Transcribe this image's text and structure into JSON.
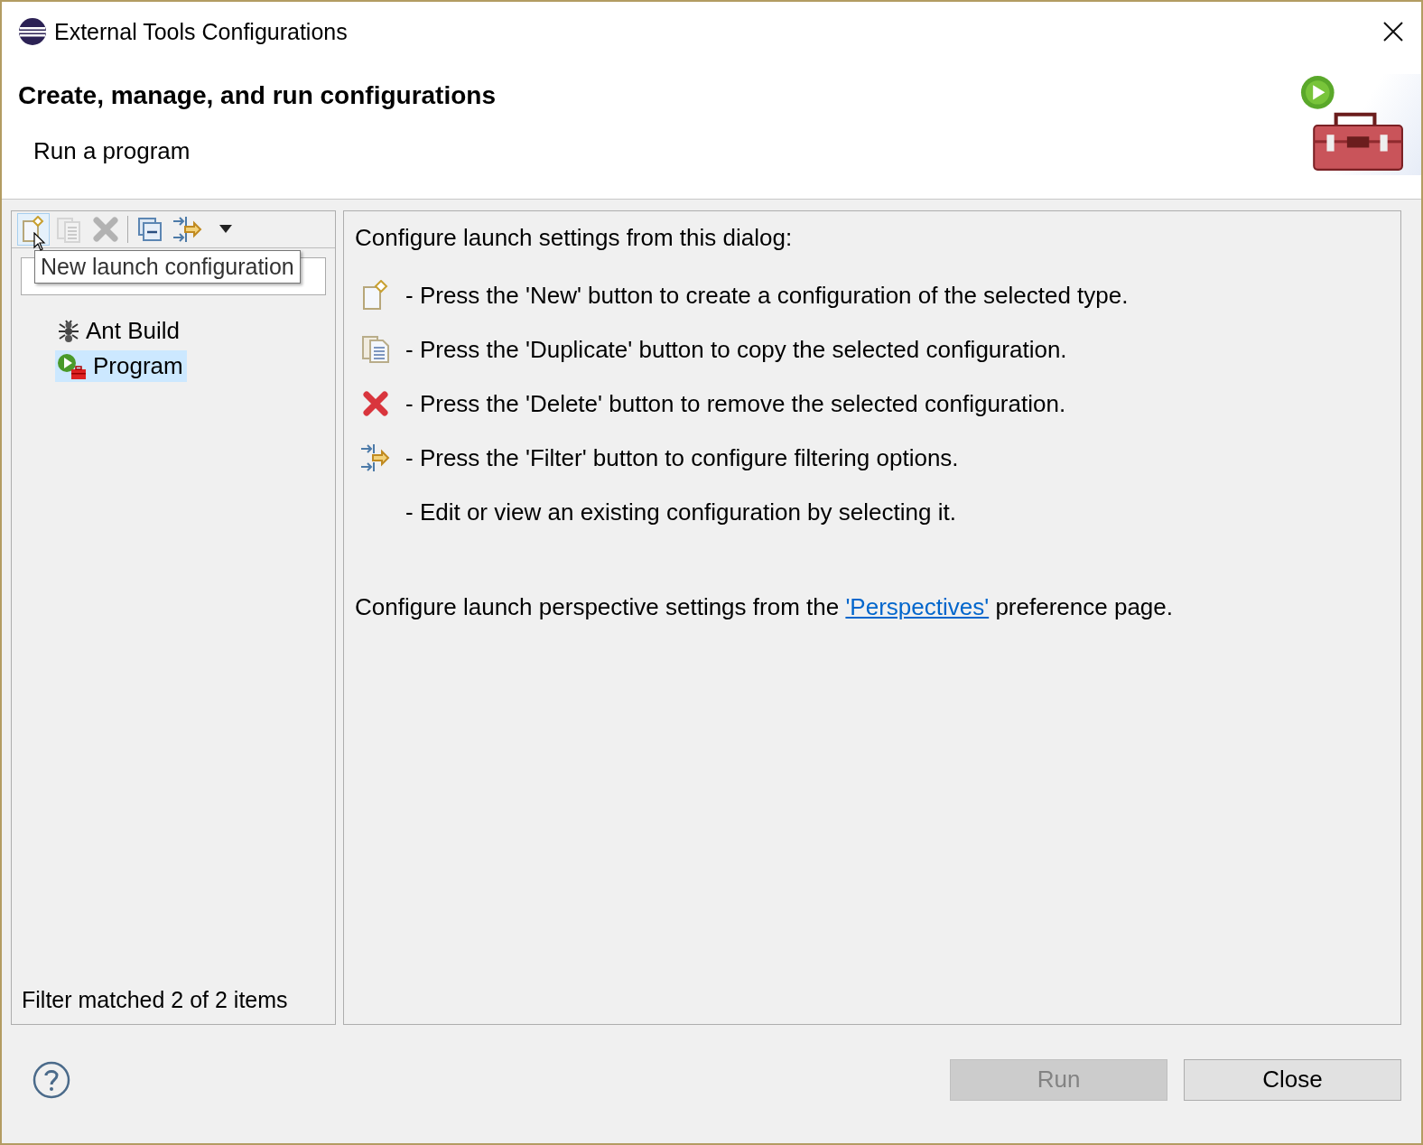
{
  "window": {
    "title": "External Tools Configurations"
  },
  "header": {
    "title": "Create, manage, and run configurations",
    "subtitle": "Run a program"
  },
  "toolbar": {
    "buttons": [
      {
        "kind": "new",
        "disabled": false,
        "hovered": true
      },
      {
        "kind": "duplicate",
        "disabled": true,
        "hovered": false
      },
      {
        "kind": "delete",
        "disabled": true,
        "hovered": false
      },
      {
        "kind": "collapse",
        "disabled": false,
        "hovered": false
      },
      {
        "kind": "filter",
        "disabled": false,
        "hovered": false
      },
      {
        "kind": "menu",
        "disabled": false,
        "hovered": false
      }
    ],
    "tooltip": "New launch configuration"
  },
  "tree": {
    "items": [
      {
        "label": "Ant Build",
        "kind": "ant",
        "selected": false
      },
      {
        "label": "Program",
        "kind": "program",
        "selected": true
      }
    ]
  },
  "filter_status": "Filter matched 2 of 2 items",
  "intro": "Configure launch settings from this dialog:",
  "instructions": [
    {
      "kind": "new",
      "text": "- Press the 'New' button to create a configuration of the selected type."
    },
    {
      "kind": "duplicate",
      "text": "- Press the 'Duplicate' button to copy the selected configuration."
    },
    {
      "kind": "delete",
      "text": "- Press the 'Delete' button to remove the selected configuration."
    },
    {
      "kind": "filter",
      "text": "- Press the 'Filter' button to configure filtering options."
    },
    {
      "kind": "none",
      "text": "- Edit or view an existing configuration by selecting it."
    }
  ],
  "perspectives": {
    "before": "Configure launch perspective settings from the",
    "link": "'Perspectives'",
    "after": "preference page."
  },
  "buttons": [
    {
      "label": "Run",
      "disabled": true
    },
    {
      "label": "Close",
      "disabled": false
    }
  ]
}
